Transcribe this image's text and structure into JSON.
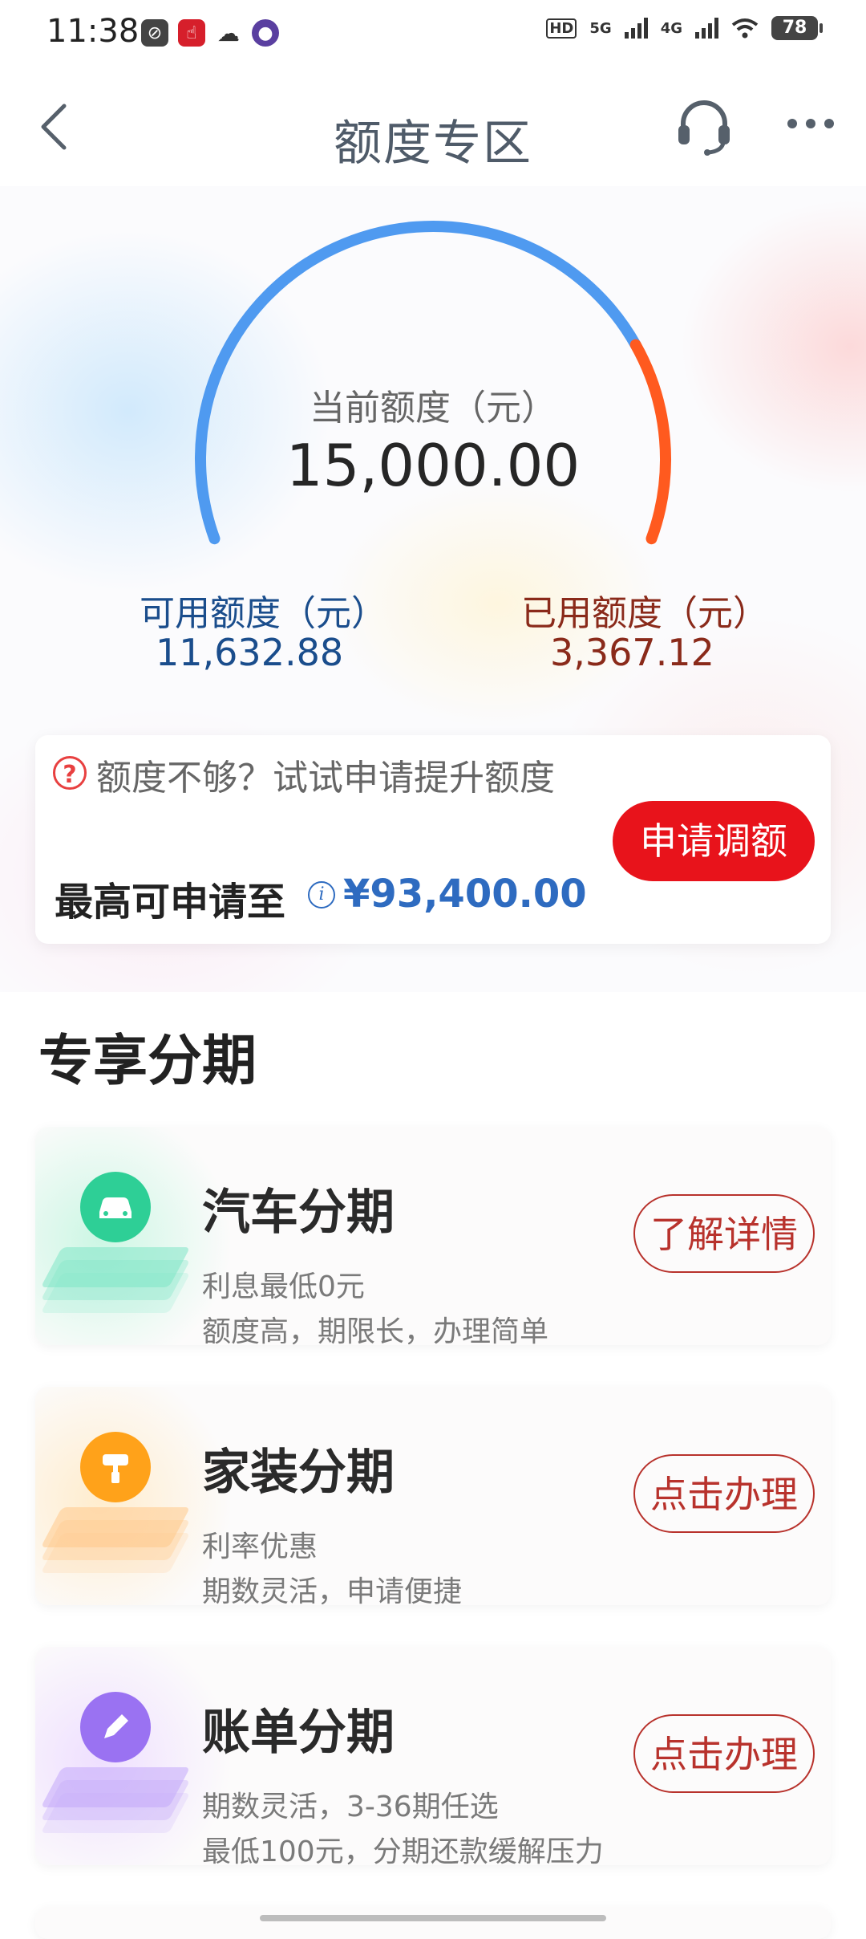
{
  "status_bar": {
    "time": "11:38",
    "battery": "78",
    "network_1": "5G",
    "network_2": "4G",
    "hd": "HD"
  },
  "header": {
    "title": "额度专区"
  },
  "credit": {
    "current_label": "当前额度（元）",
    "current_value": "15,000.00",
    "available_label": "可用额度（元）",
    "available_value": "11,632.88",
    "used_label": "已用额度（元）",
    "used_value": "3,367.12",
    "used_fraction": 0.2245,
    "colors": {
      "available": "#4f9af0",
      "used": "#ff5a1f"
    }
  },
  "promo": {
    "question": "额度不够？试试申请提升额度",
    "max_label": "最高可申请至",
    "max_value": "¥93,400.00",
    "button": "申请调额"
  },
  "section": {
    "title": "专享分期"
  },
  "products": [
    {
      "title": "汽车分期",
      "line1": "利息最低0元",
      "line2": "额度高，期限长，办理简单",
      "button": "了解详情",
      "icon": "car-icon",
      "color": "#2ecf96"
    },
    {
      "title": "家装分期",
      "line1": "利率优惠",
      "line2": "期数灵活，申请便捷",
      "button": "点击办理",
      "icon": "paint-roller-icon",
      "color": "#ffa21a"
    },
    {
      "title": "账单分期",
      "line1": "期数灵活，3-36期任选",
      "line2": "最低100元，分期还款缓解压力",
      "button": "点击办理",
      "icon": "pen-icon",
      "color": "#9a72f2"
    }
  ]
}
